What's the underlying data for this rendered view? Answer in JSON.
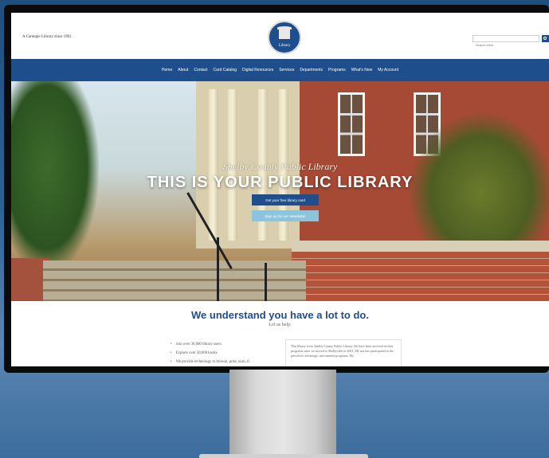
{
  "header": {
    "tagline": "A Carnegie Library since 1901",
    "logo_text": "Library",
    "search_placeholder": "Search Here"
  },
  "nav": {
    "items": [
      {
        "label": "Home"
      },
      {
        "label": "About"
      },
      {
        "label": "Contact"
      },
      {
        "label": "Card Catalog"
      },
      {
        "label": "Digital Resources"
      },
      {
        "label": "Services"
      },
      {
        "label": "Departments"
      },
      {
        "label": "Programs"
      },
      {
        "label": "What's New"
      },
      {
        "label": "My Account"
      }
    ]
  },
  "hero": {
    "script_text": "Shelby County Public Library",
    "title": "THIS IS YOUR PUBLIC LIBRARY",
    "primary_button": "Get your free library card",
    "secondary_button": "Sign up for our newsletter"
  },
  "lower": {
    "heading": "We understand you have a lot to do.",
    "subheading": "Let us help.",
    "bullets": [
      "Join over 30,000 library users",
      "Explore over 30,000 books",
      "We provide technology to browse, print, scan, fi"
    ],
    "card_text": "This library loves Shelby County Public Library. We have been involved in their programs since we moved to Shelbyville in 2001. My son has participated in the preschool, advantage, and summer programs. My"
  },
  "colors": {
    "brand_blue": "#1f4e8c",
    "light_blue_button": "#8cc4dd",
    "background": "#2b6296"
  }
}
